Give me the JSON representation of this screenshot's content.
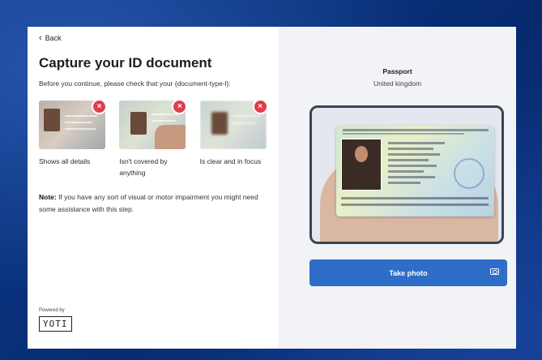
{
  "nav": {
    "back_label": "Back"
  },
  "page": {
    "title": "Capture your ID document",
    "intro": "Before you continue, please check that your {document-type-l}:"
  },
  "checks": [
    {
      "caption": "Shows all details",
      "icon": "close-icon"
    },
    {
      "caption": "Isn't covered by anything",
      "icon": "close-icon"
    },
    {
      "caption": "Is clear and in focus",
      "icon": "close-icon"
    }
  ],
  "note": {
    "label": "Note:",
    "text": " If you have any sort of visual or motor impairment you might need some assistance with this step."
  },
  "branding": {
    "powered_by": "Powered by",
    "logo_text": "YOTI"
  },
  "document": {
    "type": "Passport",
    "country": "United kingdom"
  },
  "actions": {
    "take_photo_label": "Take photo",
    "camera_icon": "camera-icon"
  },
  "colors": {
    "primary": "#2e6dc8",
    "error": "#e23b49",
    "background": "#0b2f7a"
  }
}
